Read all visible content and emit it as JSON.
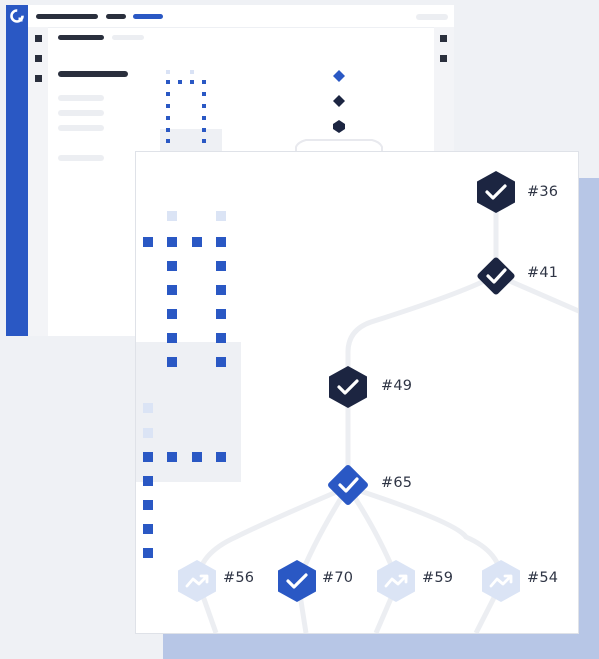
{
  "colors": {
    "page_bg": "#eff1f5",
    "brand_blue": "#2a58c4",
    "navy": "#1c2541",
    "muted_blue": "#dbe4f5",
    "accent_panel": "#b7c6e6",
    "line_gray": "#e8e9ee",
    "placeholder_gray": "#eaecef"
  },
  "icons": {
    "app_logo": "refresh-circle-logo",
    "success": "checkmark-icon",
    "pending": "trend-arrow-icon"
  },
  "pipeline": {
    "nodes": [
      {
        "id": "node-36",
        "label": "#36",
        "status": "success",
        "shape": "hexagon"
      },
      {
        "id": "node-41",
        "label": "#41",
        "status": "success",
        "shape": "diamond"
      },
      {
        "id": "node-49",
        "label": "#49",
        "status": "success",
        "shape": "hexagon"
      },
      {
        "id": "node-65",
        "label": "#65",
        "status": "success-selected",
        "shape": "diamond"
      },
      {
        "id": "node-56",
        "label": "#56",
        "status": "pending",
        "shape": "hexagon"
      },
      {
        "id": "node-70",
        "label": "#70",
        "status": "success-selected",
        "shape": "hexagon"
      },
      {
        "id": "node-59",
        "label": "#59",
        "status": "pending",
        "shape": "hexagon"
      },
      {
        "id": "node-54",
        "label": "#54",
        "status": "pending",
        "shape": "hexagon"
      }
    ]
  }
}
